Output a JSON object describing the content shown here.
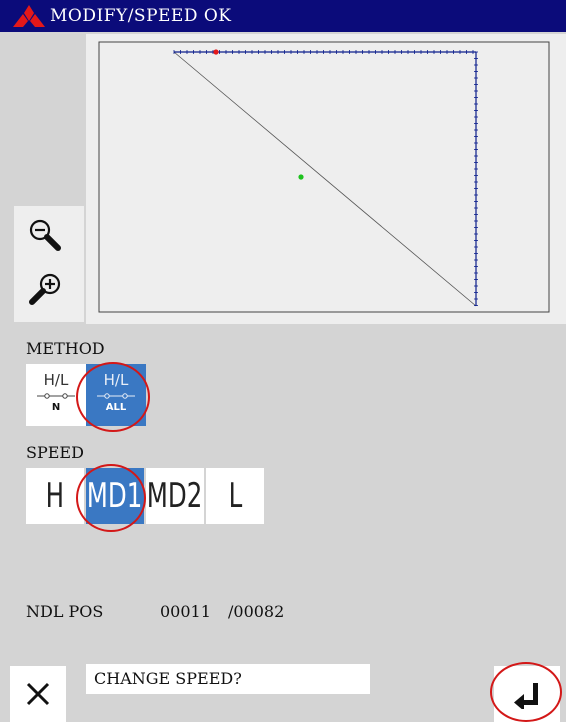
{
  "titlebar": {
    "title": "MODIFY/SPEED OK",
    "bg_color": "#0b0b7a",
    "logo_icon": "mitsubishi-logo",
    "logo_color": "#e4181a"
  },
  "preview": {
    "path_color": "#0b1d8c",
    "current_stitch_color": "#e4181a",
    "midpoint_marker_color": "#1ec21e"
  },
  "zoom": {
    "zoom_out_icon": "zoom-out-icon",
    "zoom_in_icon": "zoom-in-icon"
  },
  "method": {
    "label": "METHOD",
    "options": [
      {
        "top": "H/L",
        "bottom": "N",
        "selected": false
      },
      {
        "top": "H/L",
        "bottom": "ALL",
        "selected": true
      }
    ]
  },
  "speed": {
    "label": "SPEED",
    "options": [
      {
        "label": "H",
        "selected": false
      },
      {
        "label": "MD1",
        "selected": true
      },
      {
        "label": "MD2",
        "selected": false
      },
      {
        "label": "L",
        "selected": false
      }
    ]
  },
  "needle_position": {
    "label": "NDL POS",
    "current": "00011",
    "total": "/00082"
  },
  "footer": {
    "close_icon": "close-icon",
    "message": "CHANGE SPEED?",
    "enter_icon": "enter-icon"
  },
  "colors": {
    "background": "#d4d4d4",
    "selected": "#3a78c3",
    "highlight_circle": "#d31818"
  }
}
